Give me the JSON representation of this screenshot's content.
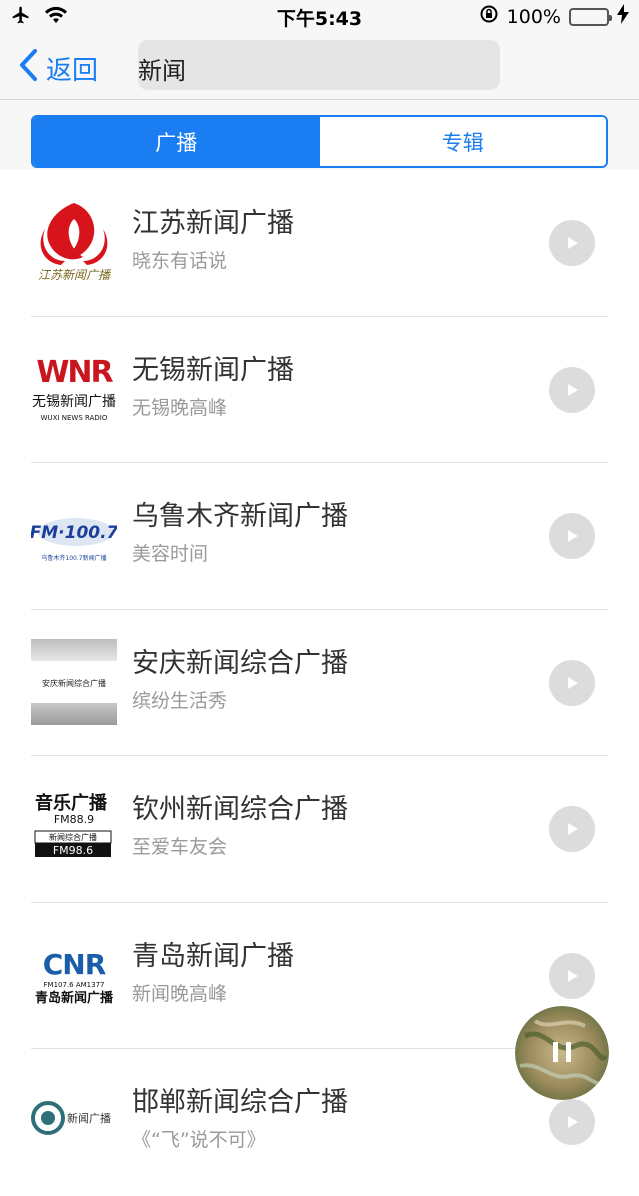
{
  "status_bar": {
    "time": "下午5:43",
    "battery_percent": "100%",
    "battery_level": 1.0,
    "icons": [
      "airplane-icon",
      "wifi-icon",
      "rotation-lock-icon",
      "battery-icon",
      "charging-icon"
    ]
  },
  "nav": {
    "back_label": "返回",
    "search_value": "新闻"
  },
  "tabs": [
    {
      "label": "广播",
      "active": true
    },
    {
      "label": "专辑",
      "active": false
    }
  ],
  "stations": [
    {
      "title": "江苏新闻广播",
      "subtitle": "晓东有话说",
      "logo_text": "江苏新闻广播"
    },
    {
      "title": "无锡新闻广播",
      "subtitle": "无锡晚高峰",
      "logo_text": "无锡新闻广播",
      "logo_text_en": "WUXI NEWS RADIO",
      "logo_mark": "WNR"
    },
    {
      "title": "乌鲁木齐新闻广播",
      "subtitle": "美容时间",
      "logo_text": "FM·100.7",
      "logo_sub": "乌鲁木齐100.7新闻广播"
    },
    {
      "title": "安庆新闻综合广播",
      "subtitle": "缤纷生活秀",
      "logo_text": "安庆新闻综合广播"
    },
    {
      "title": "钦州新闻综合广播",
      "subtitle": "至爱车友会",
      "logo_text": "音乐广播",
      "logo_freq1": "FM88.9",
      "logo_text2": "新闻综合广播",
      "logo_freq2": "FM98.6"
    },
    {
      "title": "青岛新闻广播",
      "subtitle": "新闻晚高峰",
      "logo_mark": "CNR",
      "logo_freq": "FM107.6 AM1377",
      "logo_text": "青岛新闻广播"
    },
    {
      "title": "邯郸新闻综合广播",
      "subtitle": "《“飞”说不可》",
      "logo_text": "新闻广播"
    }
  ],
  "colors": {
    "accent": "#1a7ef2",
    "play_button": "#dcdcdc",
    "divider": "#e3e3e3"
  }
}
